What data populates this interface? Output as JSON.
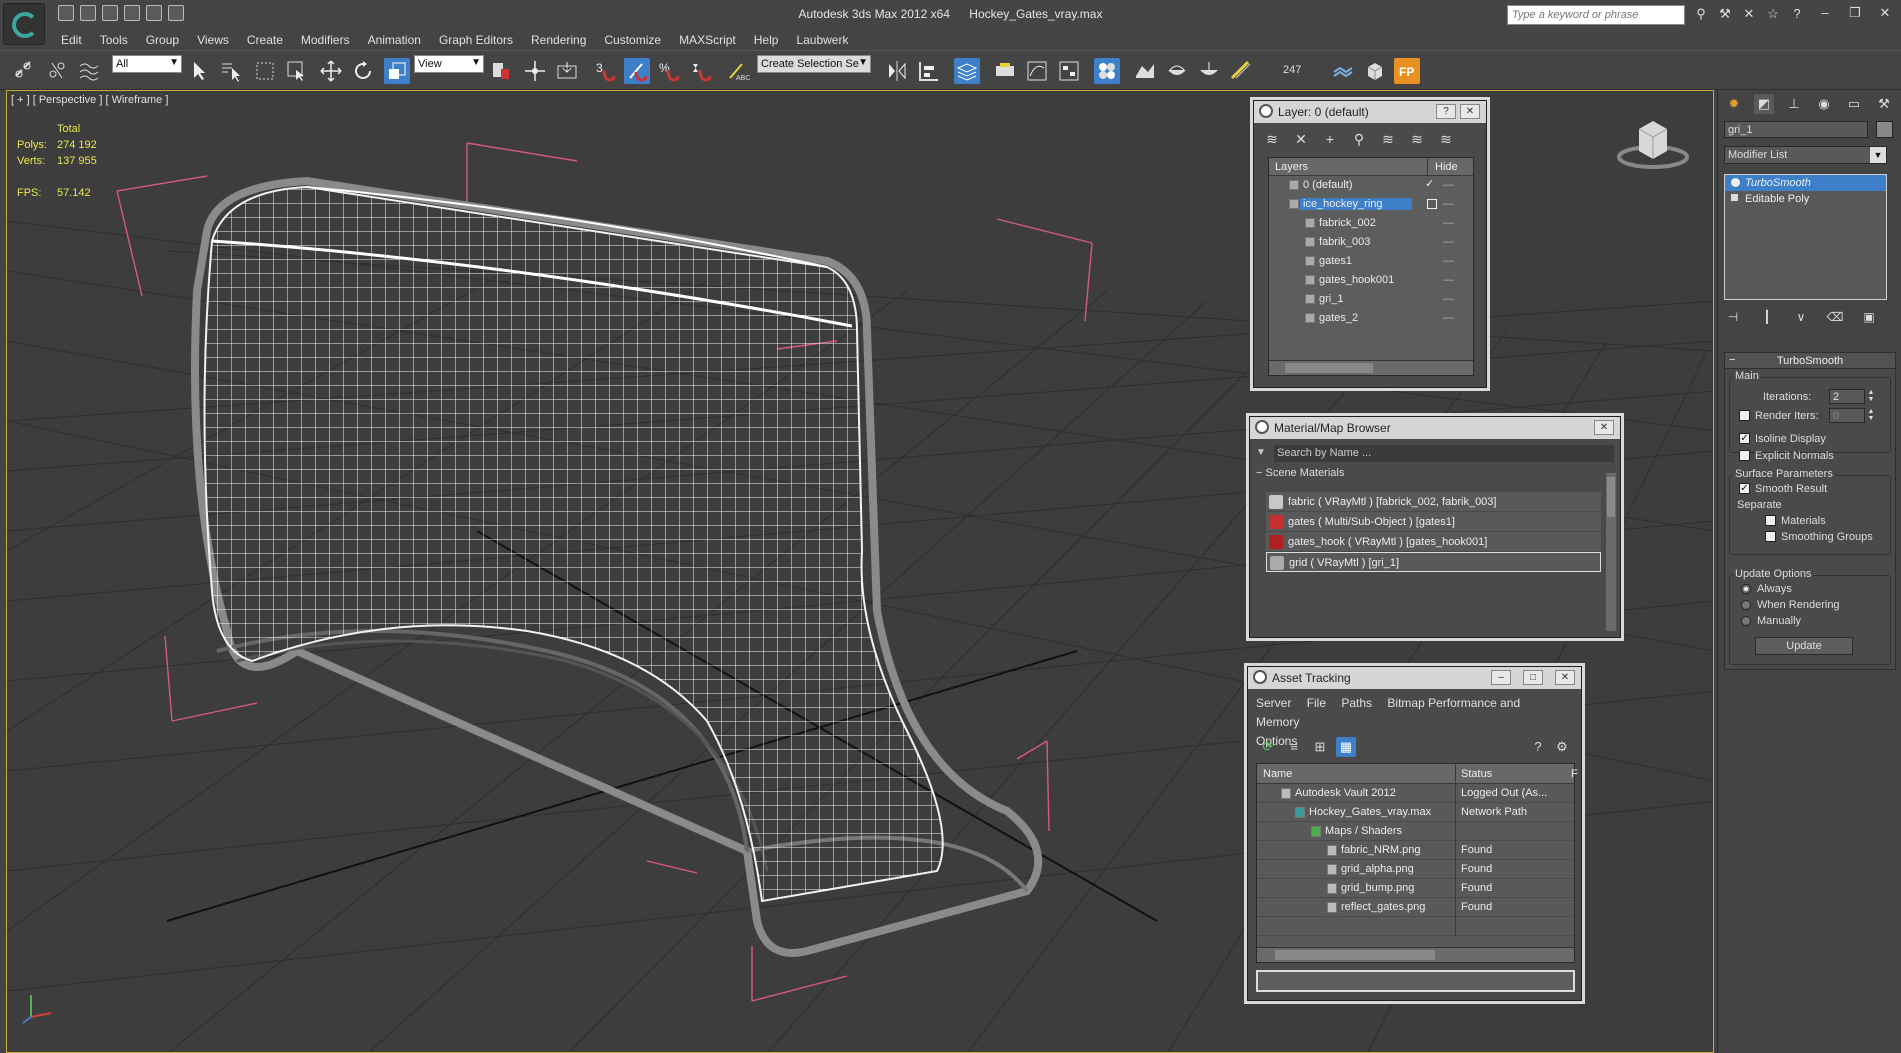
{
  "window": {
    "app_title": "Autodesk 3ds Max  2012 x64",
    "file_name": "Hockey_Gates_vray.max",
    "search_placeholder": "Type a keyword or phrase"
  },
  "menu": [
    "Edit",
    "Tools",
    "Group",
    "Views",
    "Create",
    "Modifiers",
    "Animation",
    "Graph Editors",
    "Rendering",
    "Customize",
    "MAXScript",
    "Help",
    "Laubwerk"
  ],
  "toolbar": {
    "selection_filter": "All",
    "reference_coord": "View",
    "selection_set_placeholder": "Create Selection Se",
    "counter": "247"
  },
  "viewport": {
    "label": "[ + ] [ Perspective ] [ Wireframe ]",
    "stats_header": "Total",
    "polys_label": "Polys:",
    "polys_value": "274 192",
    "verts_label": "Verts:",
    "verts_value": "137 955",
    "fps_label": "FPS:",
    "fps_value": "57.142"
  },
  "layer_dialog": {
    "title": "Layer: 0 (default)",
    "col_layers": "Layers",
    "col_hide": "Hide",
    "rows": [
      {
        "name": "0 (default)",
        "indent": 0
      },
      {
        "name": "ice_hockey_ring",
        "indent": 0
      },
      {
        "name": "fabrick_002",
        "indent": 1
      },
      {
        "name": "fabrik_003",
        "indent": 1
      },
      {
        "name": "gates1",
        "indent": 1
      },
      {
        "name": "gates_hook001",
        "indent": 1
      },
      {
        "name": "gri_1",
        "indent": 1
      },
      {
        "name": "gates_2",
        "indent": 1
      }
    ]
  },
  "material_browser": {
    "title": "Material/Map Browser",
    "search_placeholder": "Search by Name ...",
    "section": "Scene Materials",
    "materials": [
      {
        "label": "fabric  ( VRayMtl )  [fabrick_002, fabrik_003]",
        "color": "#c8c8c8"
      },
      {
        "label": "gates  ( Multi/Sub-Object )  [gates1]",
        "color": "#c83030"
      },
      {
        "label": "gates_hook  ( VRayMtl )  [gates_hook001]",
        "color": "#b02020"
      },
      {
        "label": "grid  ( VRayMtl )  [gri_1]",
        "color": "#aaaaaa"
      }
    ]
  },
  "asset_tracking": {
    "title": "Asset Tracking",
    "menu": [
      "Server",
      "File",
      "Paths",
      "Bitmap Performance and Memory",
      "Options"
    ],
    "col_name": "Name",
    "col_status": "Status",
    "col_extra": "F",
    "rows": [
      {
        "name": "Autodesk Vault 2012",
        "status": "Logged Out (As...",
        "indent": 1
      },
      {
        "name": "Hockey_Gates_vray.max",
        "status": "Network Path",
        "indent": 2
      },
      {
        "name": "Maps / Shaders",
        "status": "",
        "indent": 3
      },
      {
        "name": "fabric_NRM.png",
        "status": "Found",
        "indent": 4
      },
      {
        "name": "grid_alpha.png",
        "status": "Found",
        "indent": 4
      },
      {
        "name": "grid_bump.png",
        "status": "Found",
        "indent": 4
      },
      {
        "name": "reflect_gates.png",
        "status": "Found",
        "indent": 4
      }
    ]
  },
  "command_panel": {
    "object_name": "gri_1",
    "modifier_list": "Modifier List",
    "stack": [
      "TurboSmooth",
      "Editable Poly"
    ],
    "rollout_title": "TurboSmooth",
    "main_label": "Main",
    "iterations_label": "Iterations:",
    "iterations_value": "2",
    "render_iters_label": "Render Iters:",
    "render_iters_value": "0",
    "isoline_label": "Isoline Display",
    "explicit_normals_label": "Explicit Normals",
    "surface_params_label": "Surface Parameters",
    "smooth_result_label": "Smooth Result",
    "separate_label": "Separate",
    "materials_label": "Materials",
    "smoothing_groups_label": "Smoothing Groups",
    "update_options_label": "Update Options",
    "always_label": "Always",
    "when_rendering_label": "When Rendering",
    "manually_label": "Manually",
    "update_button": "Update"
  },
  "colors": {
    "accent": "#3d7fc8",
    "stats": "#e8e848",
    "gizmo": "#d85a7a",
    "viewport_border": "#c9a93a"
  }
}
